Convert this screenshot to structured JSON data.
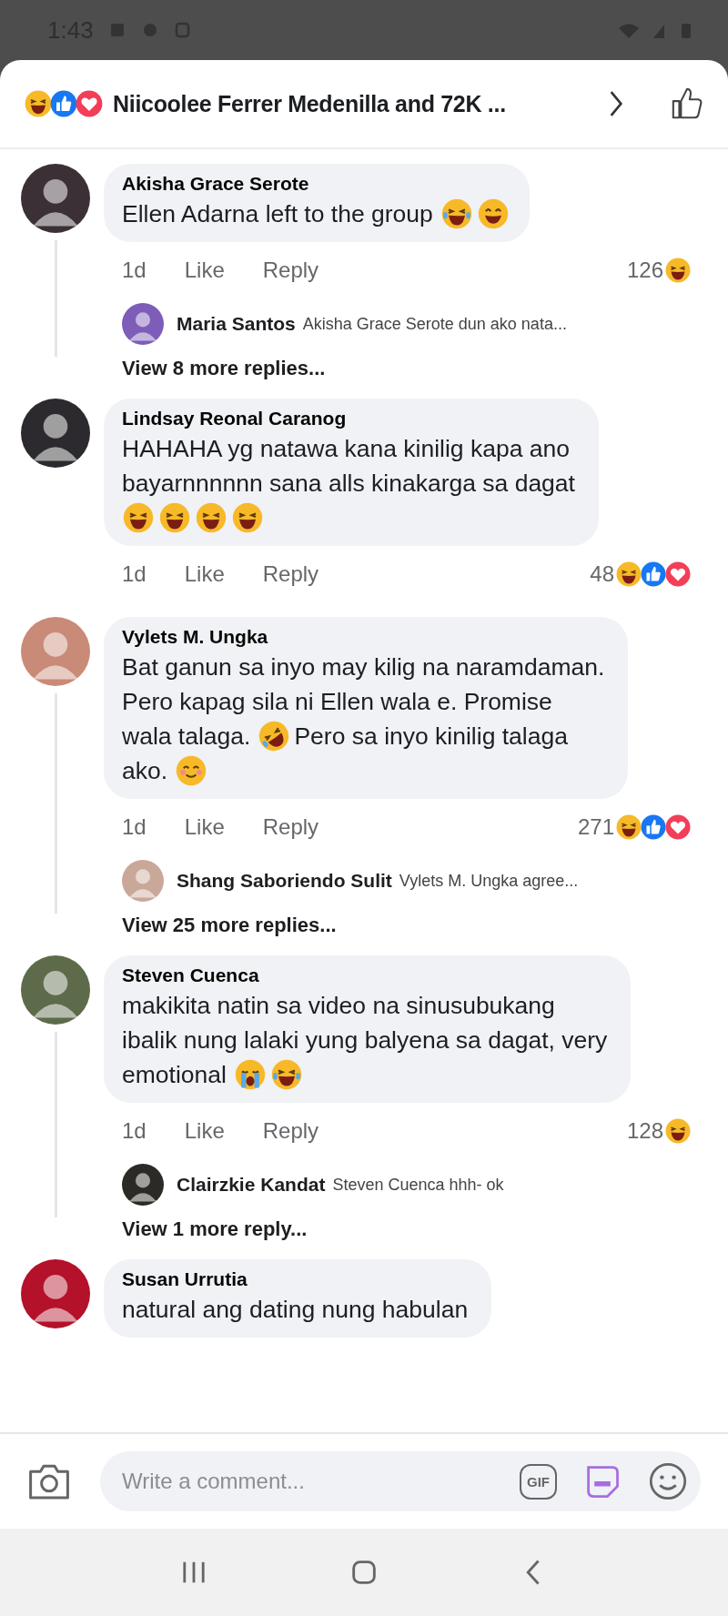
{
  "status_bar": {
    "time": "1:43"
  },
  "header": {
    "reactions": [
      {
        "kind": "haha"
      },
      {
        "kind": "like"
      },
      {
        "kind": "love"
      }
    ],
    "title": "Niicoolee Ferrer Medenilla and 72K ..."
  },
  "comments": [
    {
      "author": "Akisha Grace Serote",
      "color": "#3b3036",
      "lines": [
        [
          {
            "kind": "text",
            "text": "Ellen Adarna left to the group"
          },
          {
            "kind": "tears-of-joy"
          },
          {
            "kind": "grin"
          }
        ]
      ],
      "time": "1d",
      "like": "Like",
      "reply": "Reply",
      "reaction_count": "126",
      "reactions": [
        {
          "kind": "haha"
        }
      ],
      "replies": [
        {
          "author": "Maria Santos",
          "text": "Akisha Grace Serote dun ako nata...",
          "color": "#7d5db8"
        }
      ],
      "more": "View 8 more replies..."
    },
    {
      "author": "Lindsay Reonal Caranog",
      "color": "#2c2a2e",
      "lines": [
        [
          {
            "kind": "text",
            "text": "HAHAHA yg natawa kana kinilig kapa ano"
          }
        ],
        [
          {
            "kind": "text",
            "text": "bayarnnnnnn sana alls kinakarga sa dagat"
          }
        ],
        [
          {
            "kind": "haha"
          },
          {
            "kind": "haha"
          },
          {
            "kind": "haha"
          },
          {
            "kind": "haha"
          }
        ]
      ],
      "time": "1d",
      "like": "Like",
      "reply": "Reply",
      "reaction_count": "48",
      "reactions": [
        {
          "kind": "haha"
        },
        {
          "kind": "like"
        },
        {
          "kind": "love"
        }
      ]
    },
    {
      "author": "Vylets M. Ungka",
      "color": "#c98a78",
      "lines": [
        [
          {
            "kind": "text",
            "text": "Bat ganun sa inyo may kilig na naramdaman."
          }
        ],
        [
          {
            "kind": "text",
            "text": "Pero kapag sila ni Ellen wala e. Promise"
          }
        ],
        [
          {
            "kind": "text",
            "text": "wala talaga."
          },
          {
            "kind": "rofl"
          },
          {
            "kind": "text",
            "text": "Pero sa inyo kinilig talaga"
          }
        ],
        [
          {
            "kind": "text",
            "text": "ako."
          },
          {
            "kind": "blush"
          }
        ]
      ],
      "time": "1d",
      "like": "Like",
      "reply": "Reply",
      "reaction_count": "271",
      "reactions": [
        {
          "kind": "haha"
        },
        {
          "kind": "like"
        },
        {
          "kind": "love"
        }
      ],
      "replies": [
        {
          "author": "Shang Saboriendo Sulit",
          "text": "Vylets M. Ungka agree...",
          "color": "#c9a89a"
        }
      ],
      "more": "View 25 more replies..."
    },
    {
      "author": "Steven Cuenca",
      "color": "#5d6b4a",
      "lines": [
        [
          {
            "kind": "text",
            "text": "makikita natin sa video na sinusubukang"
          }
        ],
        [
          {
            "kind": "text",
            "text": "ibalik nung lalaki yung balyena sa dagat, very"
          }
        ],
        [
          {
            "kind": "text",
            "text": "emotional"
          },
          {
            "kind": "sob"
          },
          {
            "kind": "tears-of-joy"
          }
        ]
      ],
      "time": "1d",
      "like": "Like",
      "reply": "Reply",
      "reaction_count": "128",
      "reactions": [
        {
          "kind": "haha"
        }
      ],
      "replies": [
        {
          "author": "Clairzkie Kandat",
          "text": "Steven Cuenca hhh- ok",
          "color": "#2b2a24"
        }
      ],
      "more": "View 1 more reply..."
    },
    {
      "author": "Susan Urrutia",
      "color": "#b3122a",
      "lines": [
        [
          {
            "kind": "text",
            "text": "natural ang dating nung habulan"
          }
        ]
      ]
    }
  ],
  "composer": {
    "placeholder": "Write a comment...",
    "gif": "GIF"
  }
}
